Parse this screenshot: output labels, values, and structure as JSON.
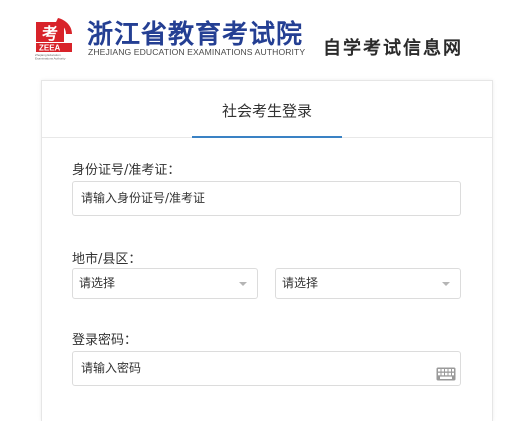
{
  "header": {
    "logo_badge_text": "ZEEA",
    "logo_badge_small": "Zhejiang Education Examinations Authority",
    "title": "浙江省教育考试院",
    "subtitle": "ZHEJIANG EDUCATION EXAMINATIONS AUTHORITY",
    "site_tag": "自学考试信息网",
    "brand_color": "#243f93",
    "logo_color": "#d8232a"
  },
  "tabs": [
    {
      "label": "社会考生登录",
      "active": true
    }
  ],
  "form": {
    "id_label": "身份证号/准考证：",
    "id_placeholder": "请输入身份证号/准考证",
    "region_label": "地市/县区：",
    "city_select": "请选择",
    "district_select": "请选择",
    "password_label": "登录密码：",
    "password_placeholder": "请输入密码",
    "keyboard_icon": "keyboard-icon"
  },
  "colors": {
    "accent": "#3a82c4",
    "border": "#dcdcdc"
  }
}
